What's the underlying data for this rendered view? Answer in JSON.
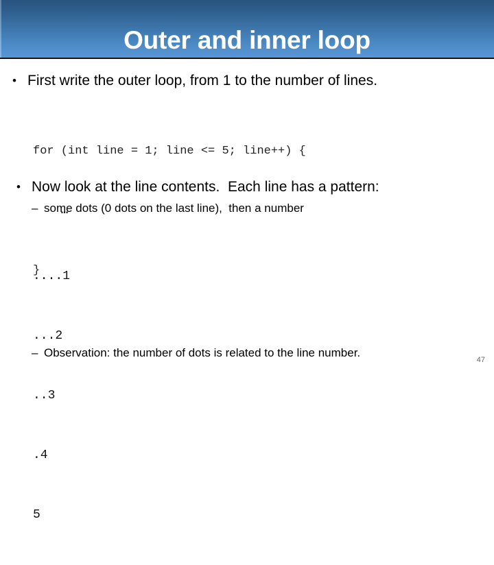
{
  "slide": {
    "title": "Outer and inner loop",
    "page_number": "47",
    "accent_color_top": "#27547f",
    "accent_color_bottom": "#5896d6",
    "title_color": "#ffffff",
    "background_color": "#ffffff"
  },
  "bullets": {
    "first": {
      "marker": "•",
      "text": "First write the outer loop, from 1 to the number of lines."
    },
    "second": {
      "marker": "•",
      "text": "Now look at the line contents.  Each line has a pattern:"
    },
    "sub_first": {
      "marker": "–",
      "text": "some dots (0 dots on the last line),  then a number"
    },
    "sub_second": {
      "marker": "–",
      "text": "Observation: the number of dots is related to the line number."
    }
  },
  "code_block": {
    "lines": [
      "for (int line = 1; line <= 5; line++) {",
      "    …",
      "}"
    ],
    "line_1": "for (int line = 1; line <= 5; line++) {",
    "line_2_indent": "    ",
    "line_2_ellipsis": "…",
    "line_3": "}"
  },
  "dot_pattern": {
    "lines": [
      "....1",
      "...2",
      "..3",
      ".4",
      "5"
    ],
    "line_1": "....1",
    "line_2": "...2",
    "line_3": "..3",
    "line_4": ".4",
    "line_5": "5"
  }
}
